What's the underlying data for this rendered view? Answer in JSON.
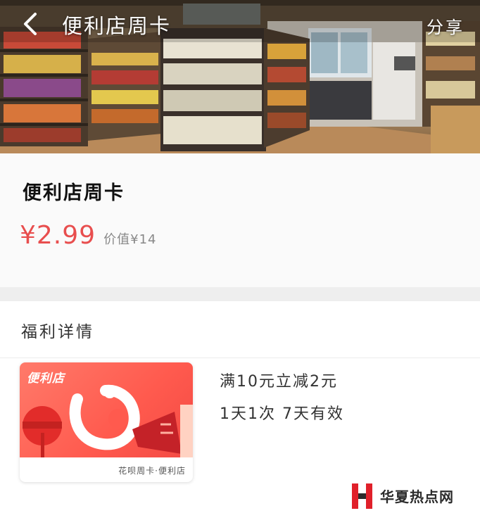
{
  "nav": {
    "title": "便利店周卡",
    "share_label": "分享"
  },
  "product": {
    "title": "便利店周卡",
    "price": "¥2.99",
    "worth": "价值¥14"
  },
  "benefits": {
    "section_title": "福利详情",
    "card": {
      "brand": "便利店",
      "caption": "花呗周卡·便利店"
    },
    "line1": "满10元立减2元",
    "line2": "1天1次  7天有效"
  },
  "watermark": {
    "text": "华夏热点网"
  },
  "colors": {
    "price_red": "#e84e4e",
    "card_red": "#ff5a4e",
    "watermark_red": "#e0202a"
  }
}
